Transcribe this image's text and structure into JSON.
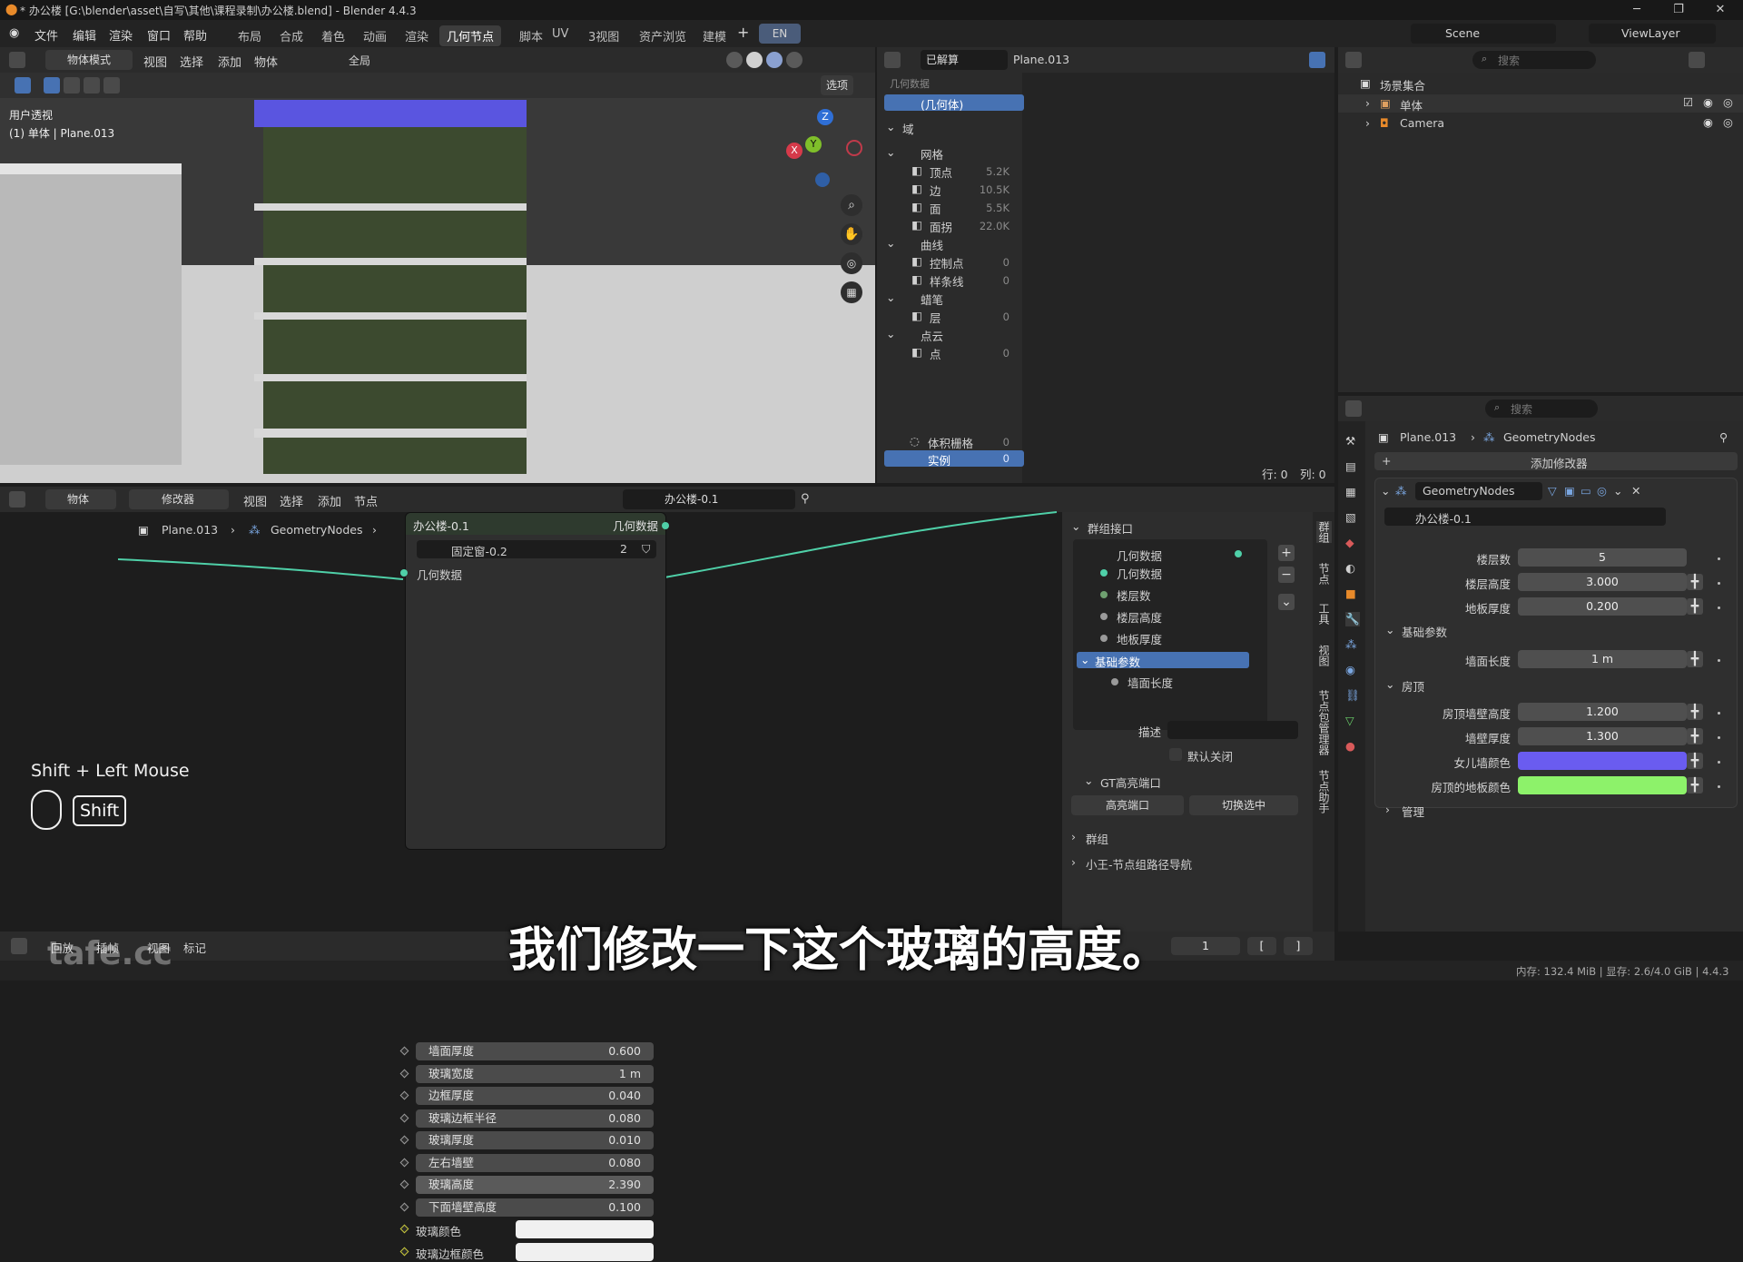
{
  "titlebar": {
    "title": "* 办公楼 [G:\\blender\\asset\\自写\\其他\\课程录制\\办公楼.blend] - Blender 4.4.3",
    "minimize": "─",
    "maximize": "❐",
    "close": "✕"
  },
  "menu": {
    "items": [
      "文件",
      "编辑",
      "渲染",
      "窗口",
      "帮助"
    ],
    "workspaces": [
      "布局",
      "合成",
      "着色",
      "动画",
      "渲染",
      "几何节点",
      "脚本",
      "UV",
      "3视图",
      "资产浏览",
      "建模"
    ],
    "active_workspace": "几何节点",
    "lang": "EN",
    "scene": "Scene",
    "view_layer": "ViewLayer"
  },
  "viewport": {
    "mode": "物体模式",
    "menus": [
      "视图",
      "选择",
      "添加",
      "物体"
    ],
    "orientation": "全局",
    "options": "选项",
    "overlay_title": "用户透视",
    "overlay_sub": "(1) 单体 | Plane.013",
    "gizmo": {
      "z": "Z",
      "y": "Y",
      "x": "X"
    }
  },
  "spreadsheet": {
    "mode": "已解算",
    "object": "Plane.013",
    "top_cut": "几何数据",
    "geometry_label": "(几何体)",
    "domain_label": "域",
    "groups": [
      {
        "name": "网格",
        "items": [
          {
            "name": "顶点",
            "count": "5.2K"
          },
          {
            "name": "边",
            "count": "10.5K"
          },
          {
            "name": "面",
            "count": "5.5K"
          },
          {
            "name": "面拐",
            "count": "22.0K"
          }
        ]
      },
      {
        "name": "曲线",
        "items": [
          {
            "name": "控制点",
            "count": "0"
          },
          {
            "name": "样条线",
            "count": "0"
          }
        ]
      },
      {
        "name": "蜡笔",
        "items": [
          {
            "name": "层",
            "count": "0"
          }
        ]
      },
      {
        "name": "点云",
        "items": [
          {
            "name": "点",
            "count": "0"
          }
        ]
      }
    ],
    "volume": {
      "name": "体积栅格",
      "count": "0"
    },
    "instance": {
      "name": "实例",
      "count": "0"
    },
    "rows": "行: 0",
    "cols": "列: 0"
  },
  "outliner": {
    "search_placeholder": "搜索",
    "collection": "场景集合",
    "items": [
      {
        "name": "单体"
      },
      {
        "name": "Camera"
      }
    ]
  },
  "node_editor": {
    "menus": [
      "物体",
      "修改器",
      "视图",
      "选择",
      "添加",
      "节点"
    ],
    "tree": "办公楼-0.1",
    "breadcrumb": [
      "Plane.013",
      "GeometryNodes",
      "办公楼-0.1"
    ],
    "node": {
      "title": "办公楼-0.1",
      "out_label": "几何数据",
      "sub_tree": "固定窗-0.2",
      "sub_users": "2",
      "in_label": "几何数据",
      "fields": [
        {
          "label": "墙面厚度",
          "value": "0.600"
        },
        {
          "label": "玻璃宽度",
          "value": "1 m"
        },
        {
          "label": "边框厚度",
          "value": "0.040"
        },
        {
          "label": "玻璃边框半径",
          "value": "0.080"
        },
        {
          "label": "玻璃厚度",
          "value": "0.010"
        },
        {
          "label": "左右墙壁",
          "value": "0.080"
        },
        {
          "label": "玻璃高度",
          "value": "2.390"
        },
        {
          "label": "下面墙壁高度",
          "value": "0.100"
        }
      ],
      "colors": [
        {
          "label": "玻璃颜色",
          "value": "#f0f0f0"
        },
        {
          "label": "玻璃边框颜色",
          "value": "#f0f0f0"
        }
      ]
    },
    "key_hint": {
      "combo": "Shift + Left Mouse",
      "key": "Shift"
    }
  },
  "interface": {
    "title": "群组接口",
    "items": [
      "几何数据",
      "几何数据",
      "楼层数",
      "楼层高度",
      "地板厚度"
    ],
    "panel": "基础参数",
    "sub_item": "墙面长度",
    "desc_label": "描述",
    "default_closed": "默认关闭",
    "gt_title": "GT高亮端口",
    "gt_btn1": "高亮端口",
    "gt_btn2": "切换选中",
    "group_title": "群组",
    "nav_title": "小王-节点组路径导航",
    "vtabs": [
      "群组",
      "节点",
      "工具",
      "视图",
      "节点包管理器",
      "节点助手"
    ]
  },
  "properties": {
    "search_placeholder": "搜索",
    "breadcrumb": [
      "Plane.013",
      "GeometryNodes"
    ],
    "add_modifier": "添加修改器",
    "modifier": "GeometryNodes",
    "tree": "办公楼-0.1",
    "fields": [
      {
        "label": "楼层数",
        "value": "5"
      },
      {
        "label": "楼层高度",
        "value": "3.000"
      },
      {
        "label": "地板厚度",
        "value": "0.200"
      }
    ],
    "panel_basic": "基础参数",
    "basic_fields": [
      {
        "label": "墙面长度",
        "value": "1 m"
      }
    ],
    "panel_roof": "房顶",
    "roof_fields": [
      {
        "label": "房顶墙壁高度",
        "value": "1.200"
      },
      {
        "label": "墙壁厚度",
        "value": "1.300"
      }
    ],
    "roof_colors": [
      {
        "label": "女儿墙颜色",
        "value": "#6a5cf0"
      },
      {
        "label": "房顶的地板颜色",
        "value": "#8df26a"
      }
    ],
    "manage": "管理"
  },
  "timeline": {
    "menus": [
      "回放",
      "插帧",
      "视图",
      "标记"
    ],
    "frame": "1"
  },
  "status": {
    "memory": "内存: 132.4 MiB | 显存: 2.6/4.0 GiB | 4.4.3"
  },
  "subtitle": "我们修改一下这个玻璃的高度。",
  "watermark": "tafe.cc"
}
